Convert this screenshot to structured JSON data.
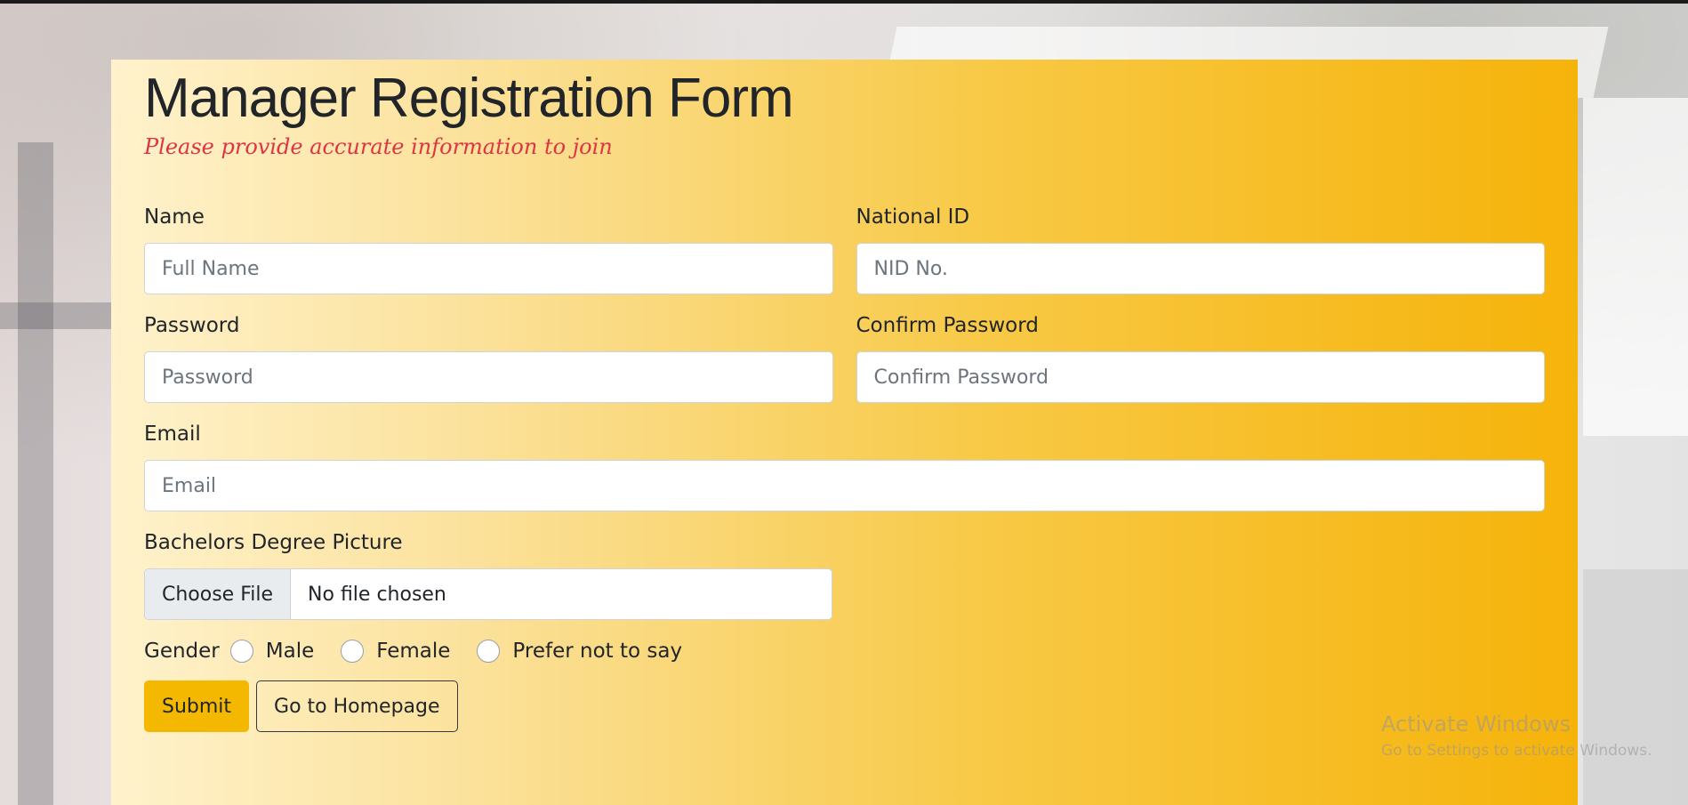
{
  "form": {
    "title": "Manager Registration Form",
    "subtitle": "Please provide accurate information to join",
    "name": {
      "label": "Name",
      "placeholder": "Full Name"
    },
    "national_id": {
      "label": "National ID",
      "placeholder": "NID No."
    },
    "password": {
      "label": "Password",
      "placeholder": "Password"
    },
    "confirm_password": {
      "label": "Confirm Password",
      "placeholder": "Confirm Password"
    },
    "email": {
      "label": "Email",
      "placeholder": "Email"
    },
    "degree_picture": {
      "label": "Bachelors Degree Picture",
      "button": "Choose File",
      "status": "No file chosen"
    },
    "gender": {
      "label": "Gender",
      "options": [
        "Male",
        "Female",
        "Prefer not to say"
      ],
      "selected": null
    },
    "submit_label": "Submit",
    "homepage_label": "Go to Homepage"
  },
  "watermark": {
    "title": "Activate Windows",
    "subtitle": "Go to Settings to activate Windows."
  },
  "colors": {
    "card_gradient_start": "#fff2cc",
    "card_gradient_end": "#f6b30a",
    "subtitle": "#dc3545",
    "submit_button": "#f5b800"
  }
}
